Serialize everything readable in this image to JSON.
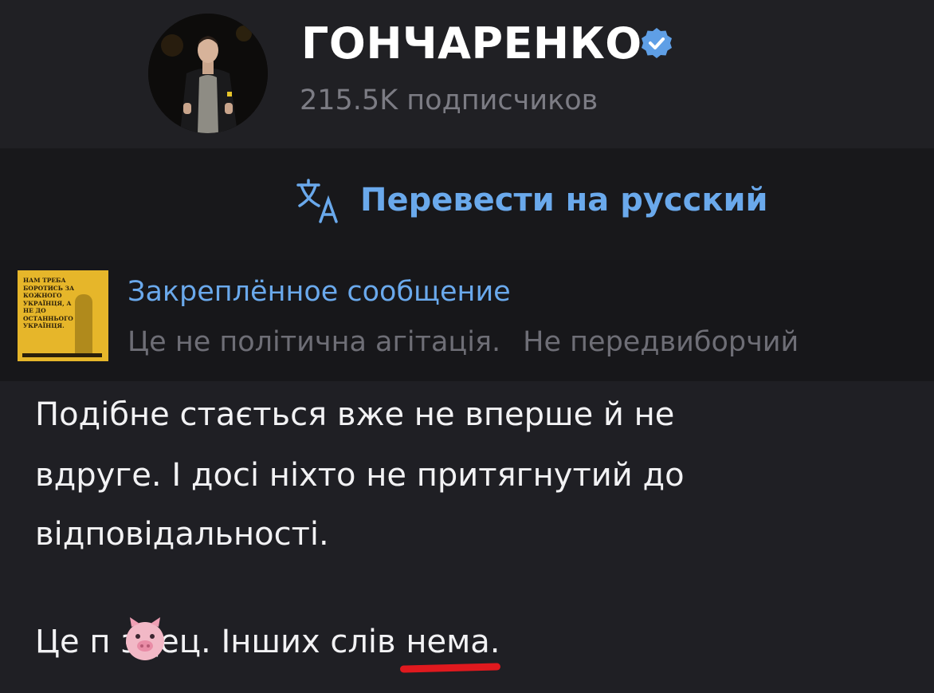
{
  "channel": {
    "title": "ГОНЧАРЕНКО",
    "subscribers": "215.5K подписчиков",
    "verified_icon": "verified-check-icon",
    "accent_color": "#6aa9ec"
  },
  "translate": {
    "icon": "translate-icon",
    "label": "Перевести на русский"
  },
  "pinned": {
    "title": "Закреплённое сообщение",
    "preview_part1": "Це не політична агітація.",
    "preview_part2": "Не передвиборчий",
    "thumbnail_text": "НАМ ТРЕБА БОРОТИСЬ ЗА КОЖНОГО УКРАЇНЦЯ, А НЕ ДО ОСТАННЬОГО УКРАЇНЦЯ."
  },
  "message": {
    "lines": [
      "Подібне стається вже не вперше й не",
      "вдруге. І досі ніхто не притягнутий до",
      "відповідальності.",
      "",
      "Це п  здец. Інших слів нема."
    ],
    "sticker_icon": "pig-emoji-icon",
    "highlight_color": "#e0191e"
  }
}
